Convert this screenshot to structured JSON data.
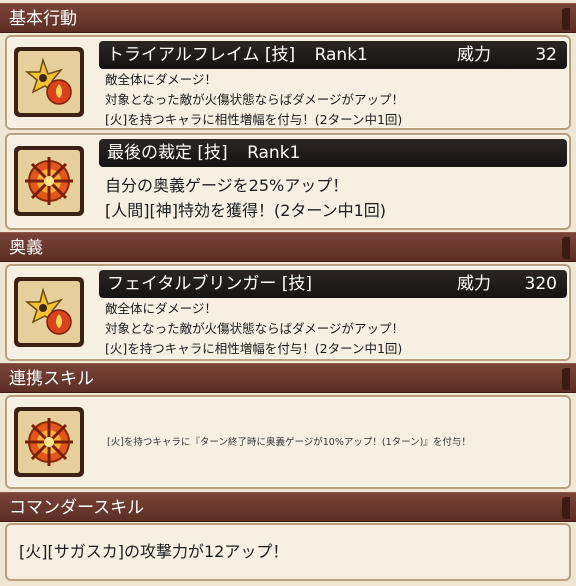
{
  "sections": {
    "basic_actions": "基本行動",
    "ougi": "奥義",
    "link_skill": "連携スキル",
    "commander_skill": "コマンダースキル"
  },
  "skills": [
    {
      "name": "トライアルフレイム [技]",
      "rank": "Rank1",
      "power_label": "威力",
      "power": "32",
      "icon": "shuriken-fire-icon",
      "lines": [
        "敵全体にダメージ！",
        "対象となった敵が火傷状態ならばダメージがアップ！",
        "[火]を持つキャラに相性増幅を付与！(2ターン中1回)"
      ]
    },
    {
      "name": "最後の裁定 [技]",
      "rank": "Rank1",
      "icon": "fire-sigil-icon",
      "lines": [
        "自分の奥義ゲージを25%アップ！",
        "[人間][神]特効を獲得！(2ターン中1回)"
      ]
    },
    {
      "name": "フェイタルブリンガー [技]",
      "power_label": "威力",
      "power": "320",
      "icon": "shuriken-fire-icon",
      "lines": [
        "敵全体にダメージ！",
        "対象となった敵が火傷状態ならばダメージがアップ！",
        "[火]を持つキャラに相性増幅を付与！(2ターン中1回)"
      ]
    }
  ],
  "link": {
    "icon": "fire-sigil-icon",
    "text": "[火]を持つキャラに『ターン終了時に奥義ゲージが10%アップ！(1ターン)』を付与！"
  },
  "commander": {
    "text": "[火][サガスカ]の攻撃力が12アップ！"
  },
  "colors": {
    "header": "#6a362c",
    "titlebar": "#1f1a18",
    "card_bg": "#f7f0e2",
    "accent_fire": "#e0521b"
  }
}
